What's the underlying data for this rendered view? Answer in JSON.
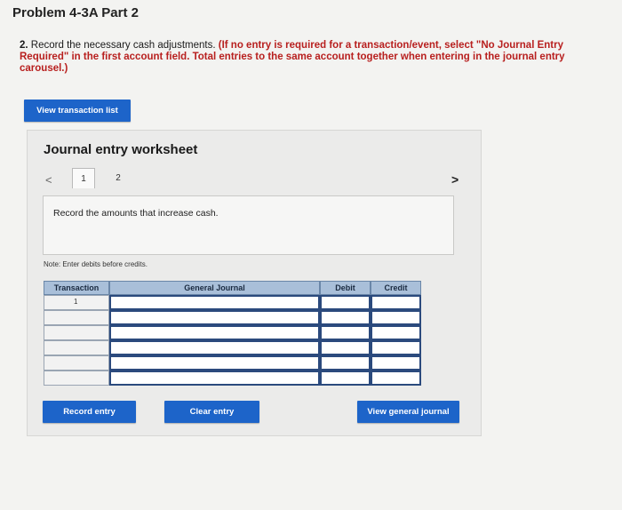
{
  "page": {
    "title": "Problem 4-3A Part 2"
  },
  "question": {
    "number": "2.",
    "text": "Record the necessary cash adjustments.",
    "instruction": "(If no entry is required for a transaction/event, select \"No Journal Entry Required\" in the first account field. Total entries to the same account together when entering in the journal entry carousel.)"
  },
  "buttons": {
    "view_transaction_list": "View transaction list",
    "record_entry": "Record entry",
    "clear_entry": "Clear entry",
    "view_general_journal": "View general journal"
  },
  "worksheet": {
    "title": "Journal entry worksheet",
    "tabs": [
      "1",
      "2"
    ],
    "prompt": "Record the amounts that increase cash.",
    "note": "Note: Enter debits before credits."
  },
  "table": {
    "headers": [
      "Transaction",
      "General Journal",
      "Debit",
      "Credit"
    ],
    "rows": [
      {
        "transaction": "1",
        "account": "",
        "debit": "",
        "credit": ""
      },
      {
        "transaction": "",
        "account": "",
        "debit": "",
        "credit": ""
      },
      {
        "transaction": "",
        "account": "",
        "debit": "",
        "credit": ""
      },
      {
        "transaction": "",
        "account": "",
        "debit": "",
        "credit": ""
      },
      {
        "transaction": "",
        "account": "",
        "debit": "",
        "credit": ""
      },
      {
        "transaction": "",
        "account": "",
        "debit": "",
        "credit": ""
      }
    ]
  },
  "colors": {
    "button": "#1d64c9",
    "header": "#a9bfd9",
    "instruction_red": "#b8201f"
  }
}
